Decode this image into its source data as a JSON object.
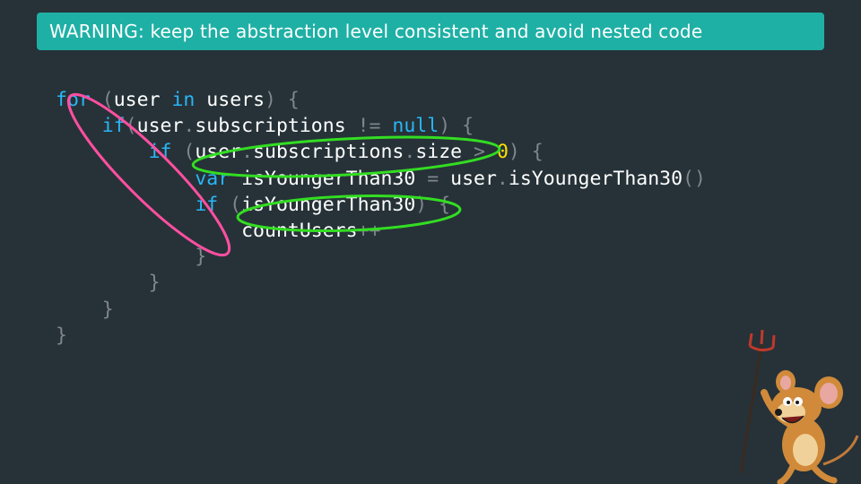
{
  "banner": {
    "text": "WARNING: keep the abstraction level consistent and avoid nested code"
  },
  "code": {
    "line1": {
      "kw_for": "for",
      "punct_open": " (",
      "var_user": "user",
      "sp1": " ",
      "kw_in": "in",
      "rest": " users",
      "punct_close": ") {"
    },
    "line2": {
      "indent": "    ",
      "kw_if": "if",
      "punct_open": "(",
      "expr": "user",
      "dot": ".",
      "expr2": "subscriptions",
      "op_ne": " != ",
      "kw_null": "null",
      "punct_close": ") {"
    },
    "line3": {
      "indent": "        ",
      "kw_if": "if",
      "punct_open": " (",
      "expr": "user",
      "dot1": ".",
      "expr2": "subscriptions",
      "dot2": ".",
      "expr3": "size",
      "op_gt": " > ",
      "num_zero": "0",
      "punct_close": ") {"
    },
    "line4": {
      "indent": "            ",
      "kw_var": "var",
      "decl": " isYoungerThan30",
      "op_eq": " = ",
      "call": "user",
      "dot": ".",
      "call2": "isYoungerThan30",
      "parens": "()"
    },
    "line5": {
      "indent": "            ",
      "kw_if": "if",
      "punct_open": " (",
      "cond": "isYoungerThan30",
      "punct_close": ") {"
    },
    "line6": {
      "indent": "                ",
      "stmt": "countUsers",
      "op_inc": "++"
    },
    "line7": {
      "indent": "            ",
      "brace": "}"
    },
    "line8": {
      "indent": "        ",
      "brace": "}"
    },
    "line9": {
      "indent": "    ",
      "brace": "}"
    },
    "line10": {
      "brace": "}"
    }
  },
  "colors": {
    "background": "#263238",
    "banner": "#1fb0a5",
    "keyword": "#29b6f6",
    "operator": "#80868b",
    "number": "#ffe000",
    "highlight_green": "#33dd22",
    "highlight_pink": "#ff4fa0"
  },
  "annotations": {
    "pink_ellipse": "nesting-depth-marker",
    "green_ellipses": [
      "condition-user-subscriptions-size",
      "condition-isYoungerThan30"
    ]
  },
  "mascot": {
    "icon": "devil-mouse-with-pitchfork-icon"
  }
}
